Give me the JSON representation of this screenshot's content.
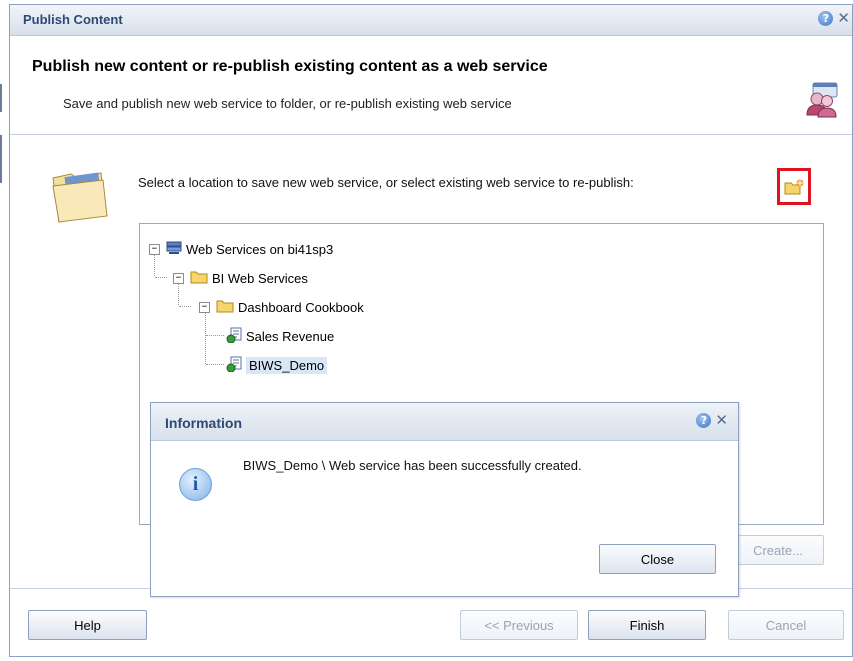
{
  "window": {
    "title": "Publish Content",
    "heading": "Publish new content or re-publish existing content as a web service",
    "subheading": "Save and publish new web service to folder, or re-publish existing web service"
  },
  "instruction": "Select a location to save new web service, or select existing web service to re-publish:",
  "tree": {
    "root": "Web Services on bi41sp3",
    "folder1": "BI Web Services",
    "folder2": "Dashboard Cookbook",
    "item1": "Sales Revenue",
    "item2": "BIWS_Demo"
  },
  "buttons": {
    "help": "Help",
    "create": "Create...",
    "previous": "<< Previous",
    "finish": "Finish",
    "cancel": "Cancel"
  },
  "dialog": {
    "title": "Information",
    "message": "BIWS_Demo \\ Web service has been successfully created.",
    "close": "Close"
  },
  "icons": {
    "help": "help-icon",
    "close": "close-icon",
    "info": "info-icon",
    "new_folder": "new-folder-icon"
  },
  "colors": {
    "title_text": "#2e4a74",
    "highlight_border": "#e0141c",
    "selection": "#d8e6f8"
  }
}
